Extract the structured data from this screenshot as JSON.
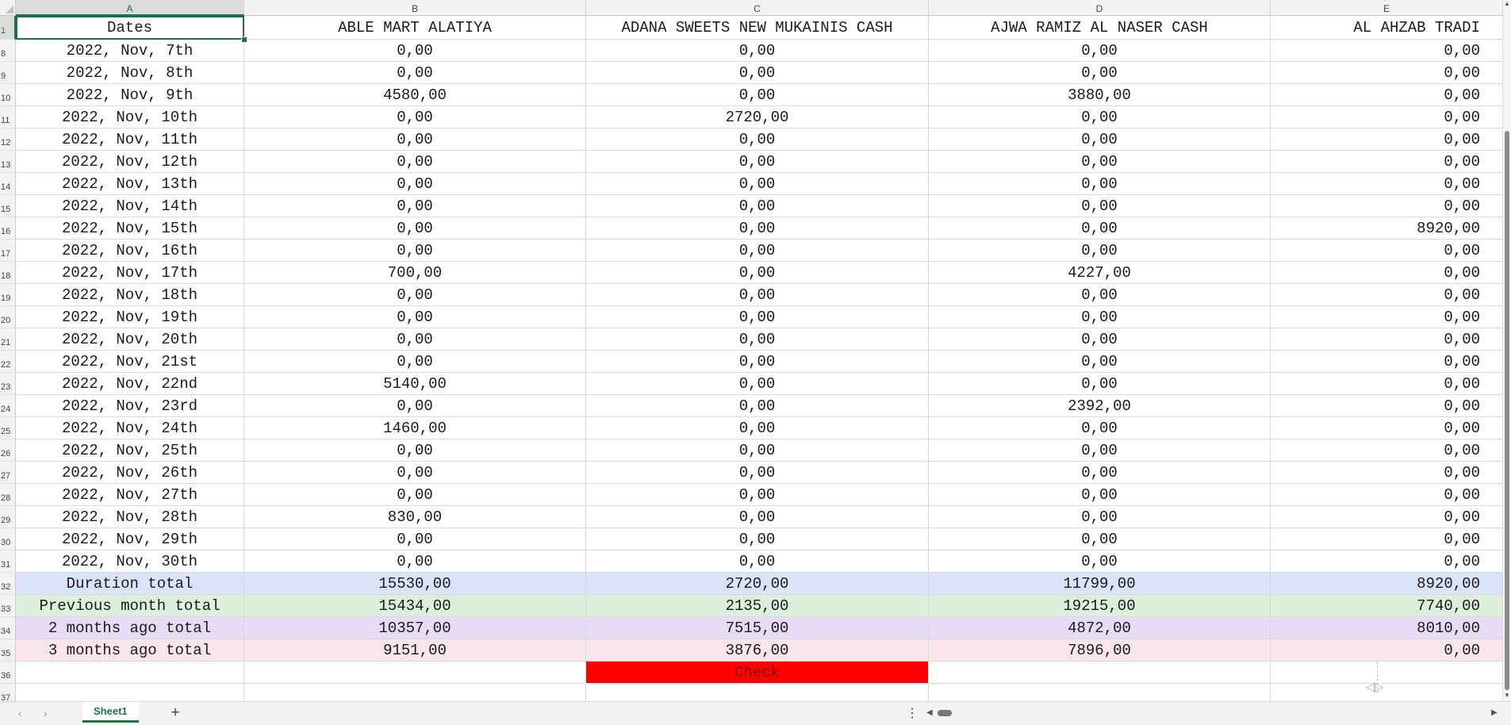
{
  "columns": [
    "A",
    "B",
    "C",
    "D",
    "E"
  ],
  "header_row": {
    "row_number": "1",
    "cells": [
      "Dates",
      "ABLE MART ALATIYA",
      "ADANA SWEETS NEW MUKAINIS CASH",
      "AJWA  RAMIZ AL NASER CASH",
      "AL AHZAB TRADI"
    ]
  },
  "rows": [
    {
      "n": "8",
      "cells": [
        "2022, Nov, 7th",
        "0,00",
        "0,00",
        "0,00",
        "0,00"
      ]
    },
    {
      "n": "9",
      "cells": [
        "2022, Nov, 8th",
        "0,00",
        "0,00",
        "0,00",
        "0,00"
      ]
    },
    {
      "n": "10",
      "cells": [
        "2022, Nov, 9th",
        "4580,00",
        "0,00",
        "3880,00",
        "0,00"
      ]
    },
    {
      "n": "11",
      "cells": [
        "2022, Nov, 10th",
        "0,00",
        "2720,00",
        "0,00",
        "0,00"
      ]
    },
    {
      "n": "12",
      "cells": [
        "2022, Nov, 11th",
        "0,00",
        "0,00",
        "0,00",
        "0,00"
      ]
    },
    {
      "n": "13",
      "cells": [
        "2022, Nov, 12th",
        "0,00",
        "0,00",
        "0,00",
        "0,00"
      ]
    },
    {
      "n": "14",
      "cells": [
        "2022, Nov, 13th",
        "0,00",
        "0,00",
        "0,00",
        "0,00"
      ]
    },
    {
      "n": "15",
      "cells": [
        "2022, Nov, 14th",
        "0,00",
        "0,00",
        "0,00",
        "0,00"
      ]
    },
    {
      "n": "16",
      "cells": [
        "2022, Nov, 15th",
        "0,00",
        "0,00",
        "0,00",
        "8920,00"
      ]
    },
    {
      "n": "17",
      "cells": [
        "2022, Nov, 16th",
        "0,00",
        "0,00",
        "0,00",
        "0,00"
      ]
    },
    {
      "n": "18",
      "cells": [
        "2022, Nov, 17th",
        "700,00",
        "0,00",
        "4227,00",
        "0,00"
      ]
    },
    {
      "n": "19",
      "cells": [
        "2022, Nov, 18th",
        "0,00",
        "0,00",
        "0,00",
        "0,00"
      ]
    },
    {
      "n": "20",
      "cells": [
        "2022, Nov, 19th",
        "0,00",
        "0,00",
        "0,00",
        "0,00"
      ]
    },
    {
      "n": "21",
      "cells": [
        "2022, Nov, 20th",
        "0,00",
        "0,00",
        "0,00",
        "0,00"
      ]
    },
    {
      "n": "22",
      "cells": [
        "2022, Nov, 21st",
        "0,00",
        "0,00",
        "0,00",
        "0,00"
      ]
    },
    {
      "n": "23",
      "cells": [
        "2022, Nov, 22nd",
        "5140,00",
        "0,00",
        "0,00",
        "0,00"
      ]
    },
    {
      "n": "24",
      "cells": [
        "2022, Nov, 23rd",
        "0,00",
        "0,00",
        "2392,00",
        "0,00"
      ]
    },
    {
      "n": "25",
      "cells": [
        "2022, Nov, 24th",
        "1460,00",
        "0,00",
        "0,00",
        "0,00"
      ]
    },
    {
      "n": "26",
      "cells": [
        "2022, Nov, 25th",
        "0,00",
        "0,00",
        "0,00",
        "0,00"
      ]
    },
    {
      "n": "27",
      "cells": [
        "2022, Nov, 26th",
        "0,00",
        "0,00",
        "0,00",
        "0,00"
      ]
    },
    {
      "n": "28",
      "cells": [
        "2022, Nov, 27th",
        "0,00",
        "0,00",
        "0,00",
        "0,00"
      ]
    },
    {
      "n": "29",
      "cells": [
        "2022, Nov, 28th",
        "830,00",
        "0,00",
        "0,00",
        "0,00"
      ]
    },
    {
      "n": "30",
      "cells": [
        "2022, Nov, 29th",
        "0,00",
        "0,00",
        "0,00",
        "0,00"
      ]
    },
    {
      "n": "31",
      "cells": [
        "2022, Nov, 30th",
        "0,00",
        "0,00",
        "0,00",
        "0,00"
      ]
    },
    {
      "n": "32",
      "fill": "#dae3f8",
      "cells": [
        "Duration total",
        "15530,00",
        "2720,00",
        "11799,00",
        "8920,00"
      ]
    },
    {
      "n": "33",
      "fill": "#dcf0dc",
      "cells": [
        "Previous month total",
        "15434,00",
        "2135,00",
        "19215,00",
        "7740,00"
      ]
    },
    {
      "n": "34",
      "fill": "#e6dcf5",
      "cells": [
        "2 months ago total",
        "10357,00",
        "7515,00",
        "4872,00",
        "8010,00"
      ]
    },
    {
      "n": "35",
      "fill": "#f8e6ec",
      "cells": [
        "3 months ago total",
        "9151,00",
        "3876,00",
        "7896,00",
        "0,00"
      ]
    },
    {
      "n": "36",
      "cells": [
        "",
        "",
        "Check",
        "",
        ""
      ],
      "red_col": 2
    },
    {
      "n": "37",
      "cells": [
        "",
        "",
        "",
        "",
        ""
      ]
    }
  ],
  "colors": {
    "accent": "#1e7145",
    "check_fill": "#ff0000"
  },
  "bottom_bar": {
    "prev_icon": "‹",
    "next_icon": "›",
    "sheet_tab": "Sheet1",
    "add_sheet": "+",
    "more_icon": "⋮",
    "scroll_left": "◀",
    "scroll_right": "▶"
  }
}
